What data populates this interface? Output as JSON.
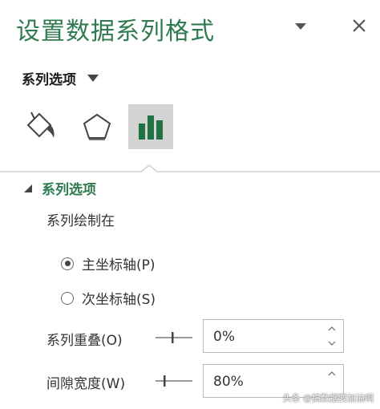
{
  "pane": {
    "title": "设置数据系列格式"
  },
  "series_menu": {
    "label": "系列选项"
  },
  "section": {
    "title": "系列选项",
    "plot_on_label": "系列绘制在",
    "radios": [
      {
        "label": "主坐标轴(P)",
        "checked": true
      },
      {
        "label": "次坐标轴(S)",
        "checked": false
      }
    ]
  },
  "fields": {
    "overlap": {
      "label": "系列重叠(O)",
      "value": "0%"
    },
    "gap_width": {
      "label": "间隙宽度(W)",
      "value": "80%"
    }
  },
  "colors": {
    "accent_green": "#2f7a4f",
    "chart_icon_green": "#217346"
  },
  "icons": {
    "fill_line": "paint-bucket-icon",
    "effects": "pentagon-icon",
    "series_options": "bar-chart-icon"
  },
  "watermark": "头条 @搞数据要加油啊"
}
